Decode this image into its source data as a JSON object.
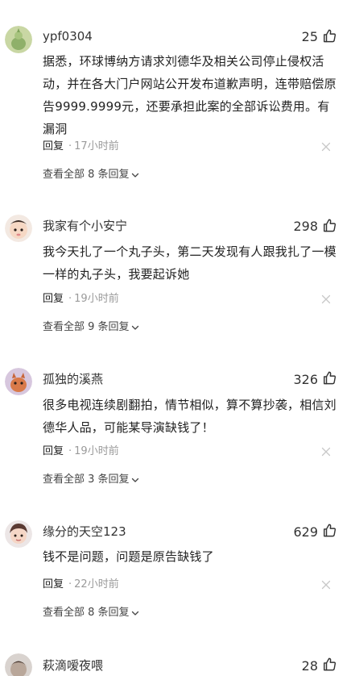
{
  "comments": [
    {
      "username": "ypf0304",
      "likes": "25",
      "text": "据悉，环球博纳方请求刘德华及相关公司停止侵权活动，并在各大门户网站公开发布道歉声明，连带赔偿原告9999.9999元，还要承担此案的全部诉讼费用。有漏洞",
      "reply_label": "回复",
      "separator": "·",
      "time": "17小时前",
      "view_all": "查看全部 8 条回复"
    },
    {
      "username": "我家有个小安宁",
      "likes": "298",
      "text": "我今天扎了一个丸子头，第二天发现有人跟我扎了一模一样的丸子头，我要起诉她",
      "reply_label": "回复",
      "separator": "·",
      "time": "19小时前",
      "view_all": "查看全部 9 条回复"
    },
    {
      "username": "孤独的溪燕",
      "likes": "326",
      "text": "很多电视连续剧翻拍，情节相似，算不算抄袭，相信刘德华人品，可能某导演缺钱了！",
      "reply_label": "回复",
      "separator": "·",
      "time": "19小时前",
      "view_all": "查看全部 3 条回复"
    },
    {
      "username": "缘分的天空123",
      "likes": "629",
      "text": "钱不是问题，问题是原告缺钱了",
      "reply_label": "回复",
      "separator": "·",
      "time": "22小时前",
      "view_all": "查看全部 8 条回复"
    },
    {
      "username": "萩滴嗳夜喂",
      "likes": "28"
    }
  ],
  "icons": {
    "like": "thumbs-up-icon",
    "close": "close-icon",
    "expand": "chevron-down-icon"
  },
  "colors": {
    "text": "#222222",
    "muted": "#9a9a9a",
    "close": "#c8c8c8"
  }
}
